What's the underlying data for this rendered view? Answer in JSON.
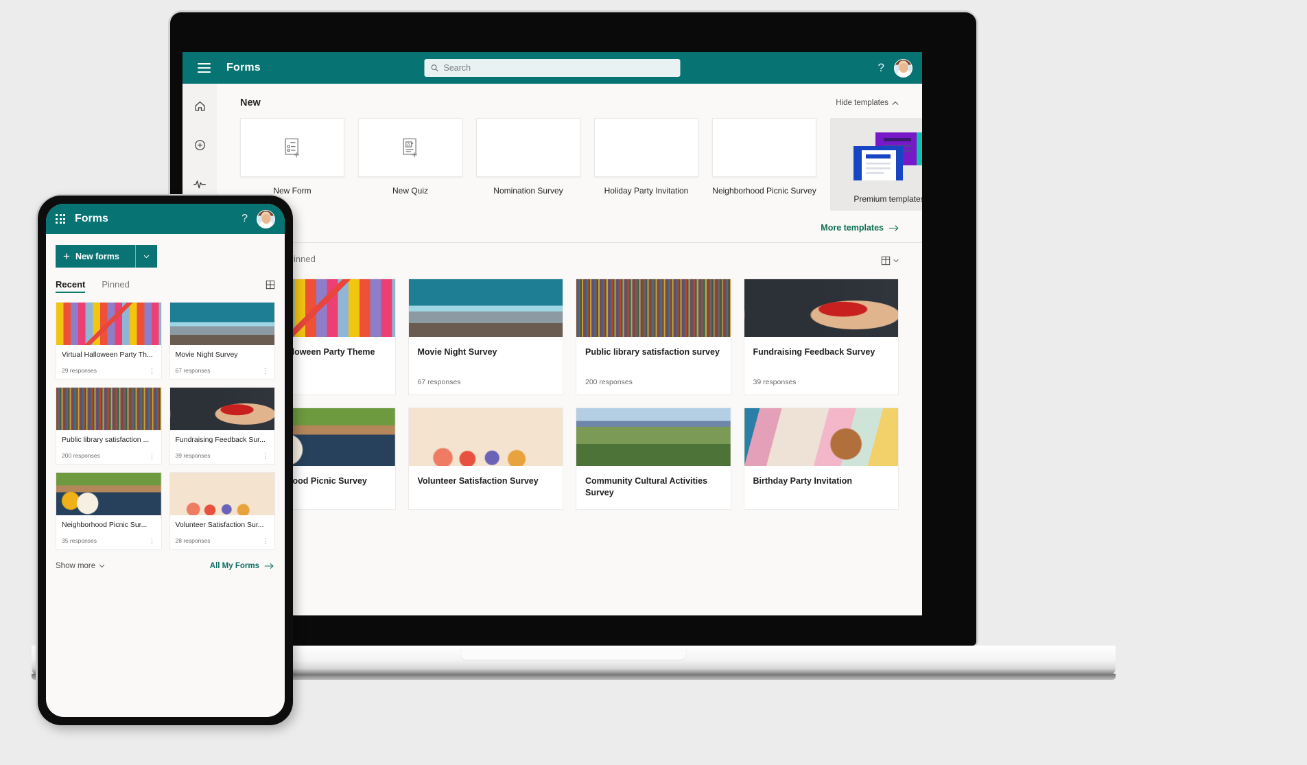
{
  "brand": {
    "teal": "#077373",
    "accent_green": "#0e6e52",
    "premium_green": "#077d63"
  },
  "desktop": {
    "header": {
      "title": "Forms",
      "menu_icon": "hamburger-icon",
      "search": {
        "placeholder": "Search",
        "value": "",
        "icon": "search-icon"
      },
      "help_label": "?",
      "avatar_label": ""
    },
    "rail": [
      {
        "name": "home",
        "icon": "home-icon"
      },
      {
        "name": "create",
        "icon": "plus-circle-icon"
      },
      {
        "name": "activity",
        "icon": "pulse-icon"
      }
    ],
    "new_section": {
      "title": "New",
      "hide_templates_label": "Hide templates",
      "templates": [
        {
          "label": "New Form",
          "thumb": "form-icon"
        },
        {
          "label": "New Quiz",
          "thumb": "quiz-icon"
        },
        {
          "label": "Nomination Survey",
          "thumb": "im-pencils"
        },
        {
          "label": "Holiday Party Invitation",
          "thumb": "im-sparkler"
        },
        {
          "label": "Neighborhood Picnic Survey",
          "thumb": "im-picnic"
        },
        {
          "label": "Premium templates",
          "thumb": "im-premium",
          "premium": true
        }
      ],
      "more_templates_label": "More templates"
    },
    "forms_section": {
      "tabs": [
        {
          "label": "Recent",
          "active": true
        },
        {
          "label": "Pinned",
          "active": false
        }
      ],
      "view_toggle_icon": "grid-view-icon",
      "cards": [
        {
          "title": "Virtual Halloween Party Theme",
          "responses": "29 responses",
          "thumb": "im-halloween"
        },
        {
          "title": "Movie Night Survey",
          "responses": "67 responses",
          "thumb": "im-mountain"
        },
        {
          "title": "Public library satisfaction survey",
          "responses": "200 responses",
          "thumb": "im-library"
        },
        {
          "title": "Fundraising Feedback Survey",
          "responses": "39 responses",
          "thumb": "im-heart"
        },
        {
          "title": "Neighborhood Picnic Survey",
          "responses": "",
          "thumb": "im-picnic"
        },
        {
          "title": "Volunteer Satisfaction Survey",
          "responses": "",
          "thumb": "im-volunteer"
        },
        {
          "title": "Community Cultural Activities Survey",
          "responses": "",
          "thumb": "im-community"
        },
        {
          "title": "Birthday Party Invitation",
          "responses": "",
          "thumb": "im-birthday"
        }
      ]
    }
  },
  "phone": {
    "header": {
      "title": "Forms",
      "waffle_icon": "app-launcher-icon",
      "help_label": "?"
    },
    "new_forms_button": {
      "label": "New forms",
      "plus": "+",
      "chevron": "⌄"
    },
    "tabs": [
      {
        "label": "Recent",
        "active": true
      },
      {
        "label": "Pinned",
        "active": false
      }
    ],
    "view_toggle_icon": "grid-view-icon",
    "cards": [
      {
        "title": "Virtual Halloween Party Th...",
        "responses": "29 responses",
        "thumb": "im-halloween"
      },
      {
        "title": "Movie Night Survey",
        "responses": "67 responses",
        "thumb": "im-mountain"
      },
      {
        "title": "Public library satisfaction ...",
        "responses": "200 responses",
        "thumb": "im-library"
      },
      {
        "title": "Fundraising Feedback Sur...",
        "responses": "39 responses",
        "thumb": "im-heart"
      },
      {
        "title": "Neighborhood Picnic Sur...",
        "responses": "35 responses",
        "thumb": "im-picnic"
      },
      {
        "title": "Volunteer Satisfaction Sur...",
        "responses": "28 responses",
        "thumb": "im-volunteer"
      }
    ],
    "footer": {
      "show_more_label": "Show more",
      "all_forms_label": "All My Forms"
    }
  }
}
